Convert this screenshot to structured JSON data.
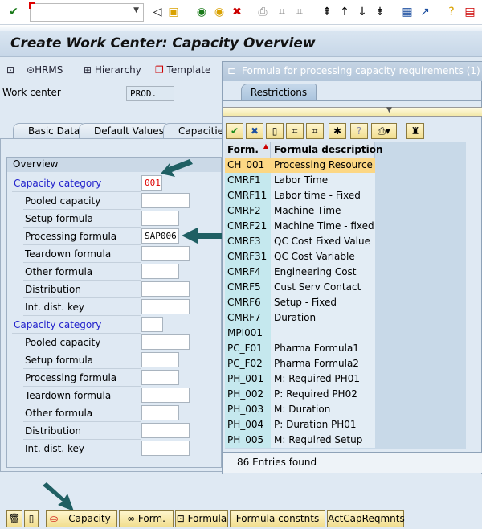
{
  "toolbar": {
    "command_field": "",
    "icons": [
      "enter-icon",
      "save-icon",
      "back-icon",
      "exit-icon",
      "cancel-icon",
      "print-icon",
      "find-icon",
      "find-next-icon",
      "first-page-icon",
      "previous-page-icon",
      "next-page-icon",
      "last-page-icon",
      "create-session-icon",
      "shortcut-icon",
      "help-icon",
      "customize-icon"
    ]
  },
  "header": {
    "title": "Create Work Center: Capacity Overview"
  },
  "app_toolbar": {
    "hrms": "HRMS",
    "hierarchy": "Hierarchy",
    "template": "Template"
  },
  "work_center": {
    "label": "Work center",
    "value": "PROD."
  },
  "tabs": [
    "Basic Data",
    "Default Values",
    "Capacities"
  ],
  "overview": {
    "title": "Overview",
    "group1": {
      "category_label": "Capacity category",
      "category_value": "001",
      "fields": [
        {
          "label": "Pooled capacity",
          "value": ""
        },
        {
          "label": "Setup formula",
          "value": ""
        },
        {
          "label": "Processing formula",
          "value": "SAP006"
        },
        {
          "label": "Teardown formula",
          "value": ""
        },
        {
          "label": "Other formula",
          "value": ""
        },
        {
          "label": "Distribution",
          "value": ""
        },
        {
          "label": "Int. dist. key",
          "value": ""
        }
      ]
    },
    "group2": {
      "category_label": "Capacity category",
      "category_value": "",
      "fields": [
        {
          "label": "Pooled capacity",
          "value": ""
        },
        {
          "label": "Setup formula",
          "value": ""
        },
        {
          "label": "Processing formula",
          "value": ""
        },
        {
          "label": "Teardown formula",
          "value": ""
        },
        {
          "label": "Other formula",
          "value": ""
        },
        {
          "label": "Distribution",
          "value": ""
        },
        {
          "label": "Int. dist. key",
          "value": ""
        }
      ]
    }
  },
  "popup": {
    "title": "Formula for processing capacity requirements (1)   86 Entries found",
    "tab": "Restrictions",
    "columns": [
      "Form.",
      "Formula description"
    ],
    "rows": [
      [
        "CH_001",
        "Processing Resource"
      ],
      [
        "CMRF1",
        "Labor Time"
      ],
      [
        "CMRF11",
        "Labor time - Fixed"
      ],
      [
        "CMRF2",
        "Machine Time"
      ],
      [
        "CMRF21",
        "Machine Time - fixed"
      ],
      [
        "CMRF3",
        "QC Cost Fixed Value"
      ],
      [
        "CMRF31",
        "QC Cost Variable"
      ],
      [
        "CMRF4",
        "Engineering Cost"
      ],
      [
        "CMRF5",
        "Cust Serv Contact"
      ],
      [
        "CMRF6",
        "Setup - Fixed"
      ],
      [
        "CMRF7",
        "Duration"
      ],
      [
        "MPI001",
        ""
      ],
      [
        "PC_F01",
        "Pharma Formula1"
      ],
      [
        "PC_F02",
        "Pharma Formula2"
      ],
      [
        "PH_001",
        "M: Required PH01"
      ],
      [
        "PH_002",
        "P: Required PH02"
      ],
      [
        "PH_003",
        "M: Duration"
      ],
      [
        "PH_004",
        "P: Duration PH01"
      ],
      [
        "PH_005",
        "M: Required Setup"
      ]
    ],
    "footer": "86 Entries found"
  },
  "bottom_buttons": {
    "capacity": "Capacity",
    "form": "Form.",
    "formula": "Formula",
    "formula_constants": "Formula constnts",
    "act_cap_reqmnts": "ActCapReqmnts"
  },
  "colors": {
    "accent_arrow": "#1f5f63",
    "selected_row": "#fcd784",
    "label_blue": "#2222cc"
  }
}
